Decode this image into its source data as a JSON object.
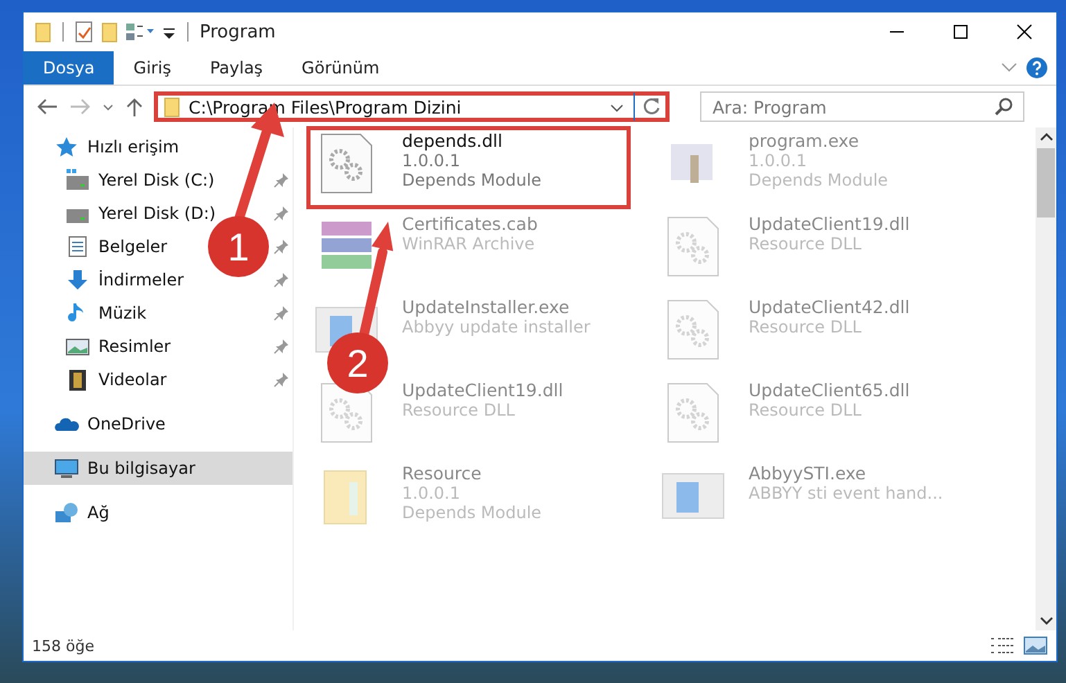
{
  "window": {
    "title": "Program"
  },
  "ribbon_tabs": [
    {
      "label": "Dosya",
      "selected": true
    },
    {
      "label": "Giriş",
      "selected": false
    },
    {
      "label": "Paylaş",
      "selected": false
    },
    {
      "label": "Görünüm",
      "selected": false
    }
  ],
  "address_bar": {
    "path": "C:\\Program Files\\Program Dizini",
    "callout": true
  },
  "search": {
    "placeholder": "Ara: Program"
  },
  "sidebar": {
    "items": [
      {
        "label": "Hızlı erişim",
        "kind": "star",
        "selected": false,
        "children": [
          {
            "label": "Yerel Disk (C:)",
            "kind": "drive-c",
            "pinned": true
          },
          {
            "label": "Yerel Disk (D:)",
            "kind": "drive",
            "pinned": true
          },
          {
            "label": "Belgeler",
            "kind": "document",
            "pinned": true
          },
          {
            "label": "İndirmeler",
            "kind": "download",
            "pinned": true
          },
          {
            "label": "Müzik",
            "kind": "music",
            "pinned": true
          },
          {
            "label": "Resimler",
            "kind": "picture",
            "pinned": true
          },
          {
            "label": "Videolar",
            "kind": "video",
            "pinned": true
          }
        ]
      },
      {
        "label": "OneDrive",
        "kind": "cloud",
        "selected": false
      },
      {
        "label": "Bu bilgisayar",
        "kind": "computer",
        "selected": true
      },
      {
        "label": "Ağ",
        "kind": "network",
        "selected": false
      }
    ]
  },
  "files": [
    {
      "name": "depends.dll",
      "lines": [
        "1.0.0.1",
        "Depends Module"
      ],
      "kind": "dll",
      "blurred": false,
      "callout": true
    },
    {
      "name": "program.exe",
      "lines": [
        "1.0.0.1",
        "Depends Module"
      ],
      "kind": "program",
      "blurred": true,
      "callout": false
    },
    {
      "name": "Certificates.cab",
      "lines": [
        "WinRAR Archive"
      ],
      "kind": "archive",
      "blurred": true,
      "callout": false
    },
    {
      "name": "UpdateClient19.dll",
      "lines": [
        "Resource DLL"
      ],
      "kind": "dll",
      "blurred": true,
      "callout": false
    },
    {
      "name": "UpdateInstaller.exe",
      "lines": [
        "Abbyy update installer"
      ],
      "kind": "app",
      "blurred": true,
      "callout": false
    },
    {
      "name": "UpdateClient42.dll",
      "lines": [
        "Resource DLL"
      ],
      "kind": "dll",
      "blurred": true,
      "callout": false
    },
    {
      "name": "UpdateClient19.dll",
      "lines": [
        "Resource DLL"
      ],
      "kind": "dll",
      "blurred": true,
      "callout": false
    },
    {
      "name": "UpdateClient65.dll",
      "lines": [
        "Resource DLL"
      ],
      "kind": "dll",
      "blurred": true,
      "callout": false
    },
    {
      "name": "Resource",
      "lines": [
        "1.0.0.1",
        "Depends Module"
      ],
      "kind": "folder",
      "blurred": true,
      "callout": false
    },
    {
      "name": "AbbyySTI.exe",
      "lines": [
        "ABBYY sti event hand..."
      ],
      "kind": "app",
      "blurred": true,
      "callout": false
    }
  ],
  "status_bar": {
    "count": "158 öğe"
  },
  "steps": [
    {
      "number": "1"
    },
    {
      "number": "2"
    }
  ]
}
